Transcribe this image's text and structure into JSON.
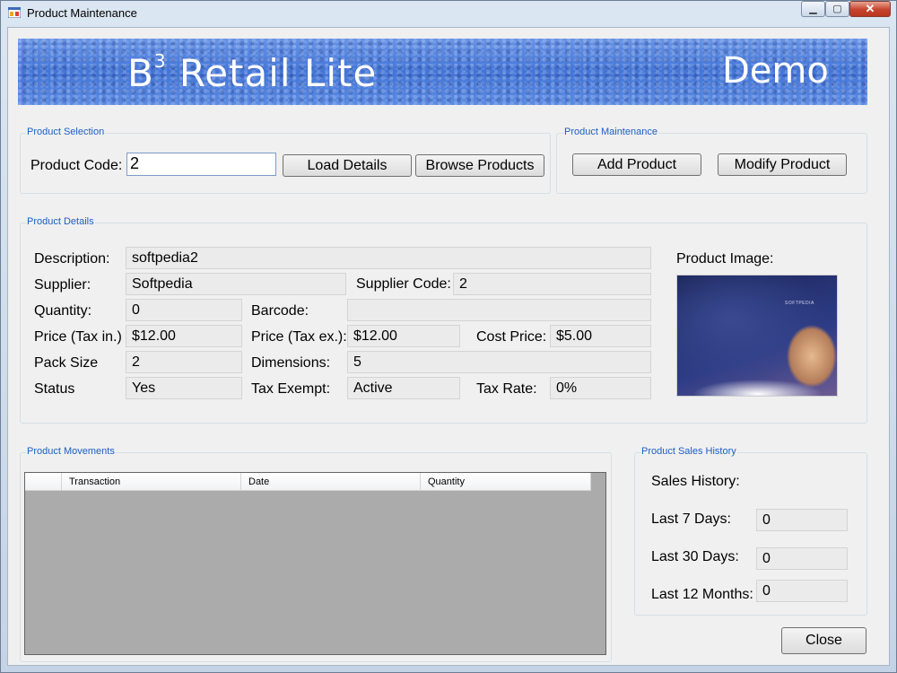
{
  "window": {
    "title": "Product Maintenance",
    "minimize_glyph": "▁",
    "maximize_glyph": "▢",
    "close_glyph": "✕"
  },
  "banner": {
    "logo_b": "B",
    "logo_sup": "3",
    "logo_rest": " Retail Lite",
    "demo": "Demo"
  },
  "product_selection": {
    "group_title": "Product Selection",
    "code_label": "Product Code:",
    "code_value": "2",
    "load_button": "Load Details",
    "browse_button": "Browse Products"
  },
  "product_maintenance": {
    "group_title": "Product Maintenance",
    "add_button": "Add Product",
    "modify_button": "Modify Product"
  },
  "product_details": {
    "group_title": "Product Details",
    "description_label": "Description:",
    "description_value": "softpedia2",
    "supplier_label": "Supplier:",
    "supplier_value": "Softpedia",
    "supplier_code_label": "Supplier Code:",
    "supplier_code_value": "2",
    "quantity_label": "Quantity:",
    "quantity_value": "0",
    "barcode_label": "Barcode:",
    "barcode_value": "",
    "price_in_label": "Price (Tax in.)",
    "price_in_value": "$12.00",
    "price_ex_label": "Price (Tax ex.):",
    "price_ex_value": "$12.00",
    "cost_label": "Cost Price:",
    "cost_value": "$5.00",
    "pack_label": "Pack Size",
    "pack_value": "2",
    "dimensions_label": "Dimensions:",
    "dimensions_value": "5",
    "status_label": "Status",
    "status_value": "Yes",
    "tax_exempt_label": "Tax Exempt:",
    "tax_exempt_value": "Active",
    "tax_rate_label": "Tax Rate:",
    "tax_rate_value": "0%",
    "image_label": "Product Image:",
    "image_caption": "SOFTPEDIA"
  },
  "movements": {
    "group_title": "Product Movements",
    "columns": [
      "Transaction",
      "Date",
      "Quantity"
    ]
  },
  "sales_history": {
    "group_title": "Product Sales History",
    "heading": "Sales History:",
    "last7_label": "Last 7 Days:",
    "last7_value": "0",
    "last30_label": "Last 30 Days:",
    "last30_value": "0",
    "last12m_label": "Last 12 Months:",
    "last12m_value": "0"
  },
  "close_button": "Close"
}
